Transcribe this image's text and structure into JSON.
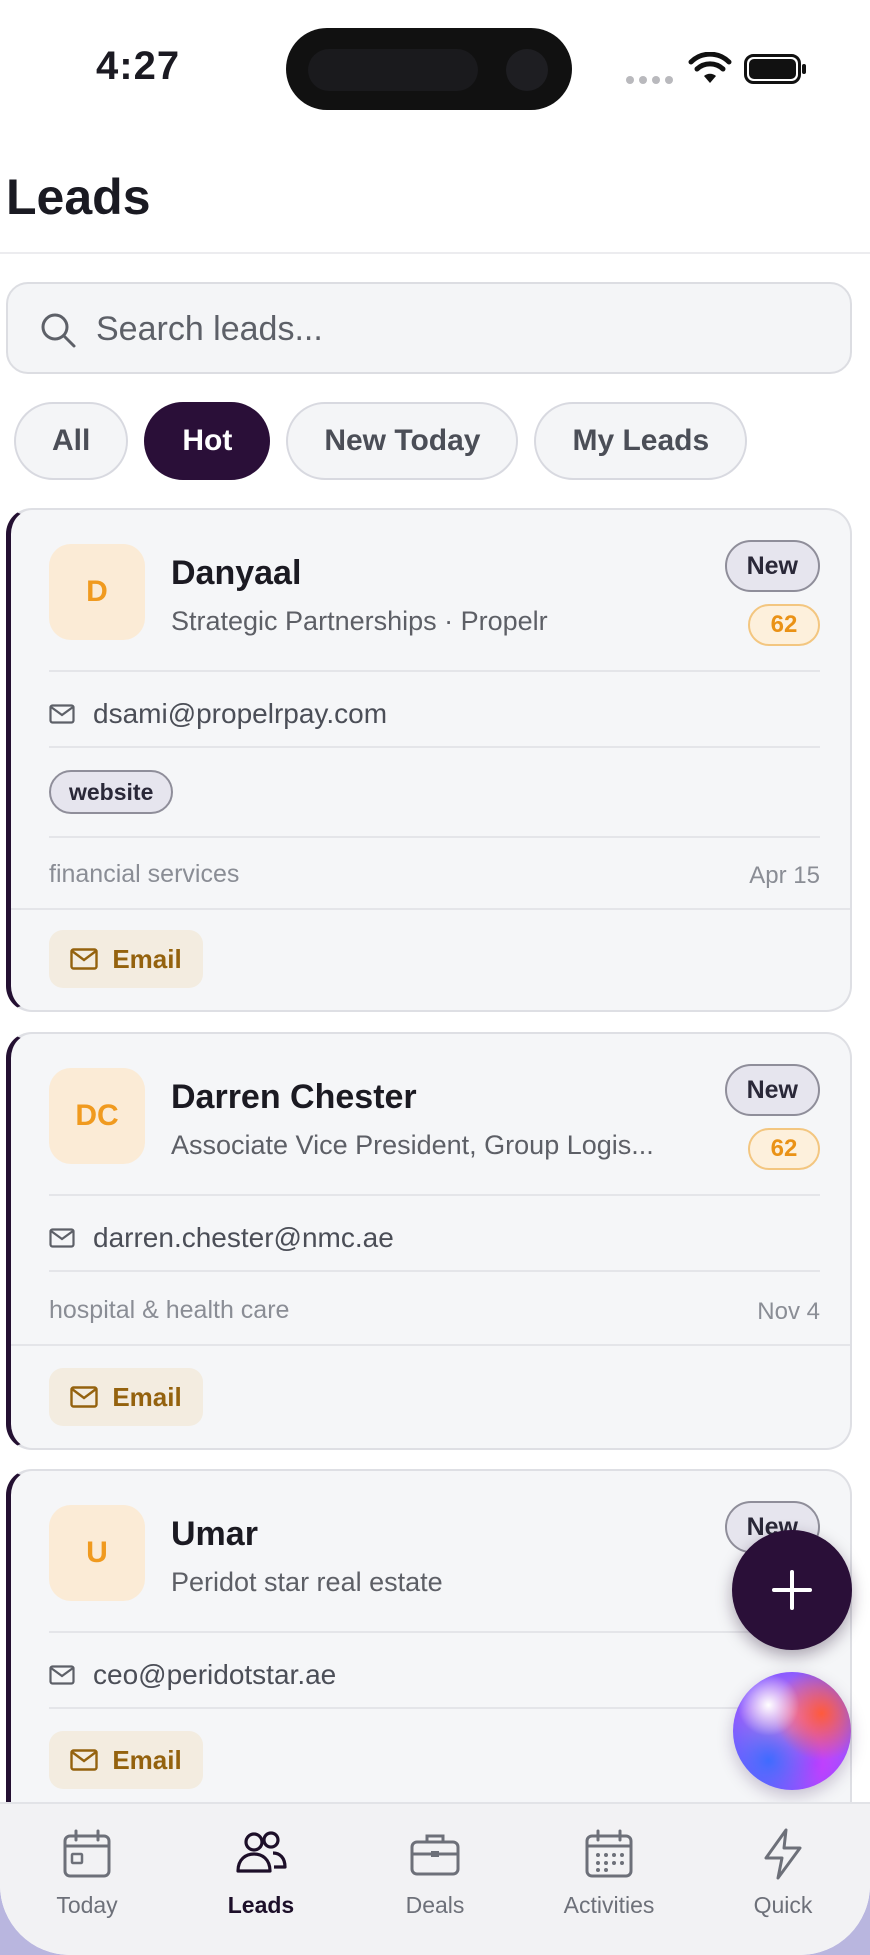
{
  "status_bar": {
    "time": "4:27"
  },
  "header": {
    "title": "Leads"
  },
  "search": {
    "placeholder": "Search leads..."
  },
  "filters": {
    "items": [
      {
        "label": "All",
        "active": false
      },
      {
        "label": "Hot",
        "active": true
      },
      {
        "label": "New Today",
        "active": false
      },
      {
        "label": "My Leads",
        "active": false
      }
    ]
  },
  "leads": [
    {
      "initials": "D",
      "name": "Danyaal",
      "subtitle": "Strategic Partnerships · Propelr",
      "status": "New",
      "score": "62",
      "email": "dsami@propelrpay.com",
      "tag": "website",
      "industry": "financial services",
      "date": "Apr 15",
      "action_label": "Email"
    },
    {
      "initials": "DC",
      "name": "Darren Chester",
      "subtitle": "Associate Vice President, Group Logis...",
      "status": "New",
      "score": "62",
      "email": "darren.chester@nmc.ae",
      "industry": "hospital & health care",
      "date": "Nov 4",
      "action_label": "Email"
    },
    {
      "initials": "U",
      "name": "Umar",
      "subtitle": "Peridot star real estate",
      "status": "New",
      "email": "ceo@peridotstar.ae",
      "action_label": "Email"
    }
  ],
  "tab_bar": {
    "items": [
      {
        "label": "Today",
        "icon": "calendar-day-icon",
        "active": false
      },
      {
        "label": "Leads",
        "icon": "users-icon",
        "active": true
      },
      {
        "label": "Deals",
        "icon": "briefcase-icon",
        "active": false
      },
      {
        "label": "Activities",
        "icon": "calendar-grid-icon",
        "active": false
      },
      {
        "label": "Quick",
        "icon": "lightning-icon",
        "active": false
      }
    ]
  },
  "colors": {
    "brand_dark": "#2a0f38",
    "score_orange": "#ea9216",
    "email_brown": "#94620e"
  }
}
